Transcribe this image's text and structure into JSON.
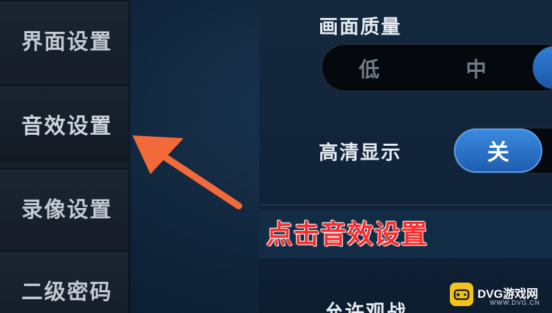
{
  "sidebar": {
    "items": [
      {
        "label": "界面设置"
      },
      {
        "label": "音效设置"
      },
      {
        "label": "录像设置"
      },
      {
        "label": "二级密码"
      }
    ]
  },
  "settings": {
    "quality": {
      "title": "画面质量",
      "options": [
        "低",
        "中"
      ],
      "selected_color": "#2a6fc8"
    },
    "hd_display": {
      "title": "高清显示",
      "toggle_label": "关"
    },
    "spectate": {
      "title": "允许观战"
    }
  },
  "annotation": {
    "text": "点击音效设置",
    "color": "#ff2a2a",
    "arrow_color": "#f36a3a"
  },
  "watermark": {
    "brand": "DVG游戏网",
    "url": "WWW.DVG.CN",
    "icon": "gamepad-icon"
  }
}
